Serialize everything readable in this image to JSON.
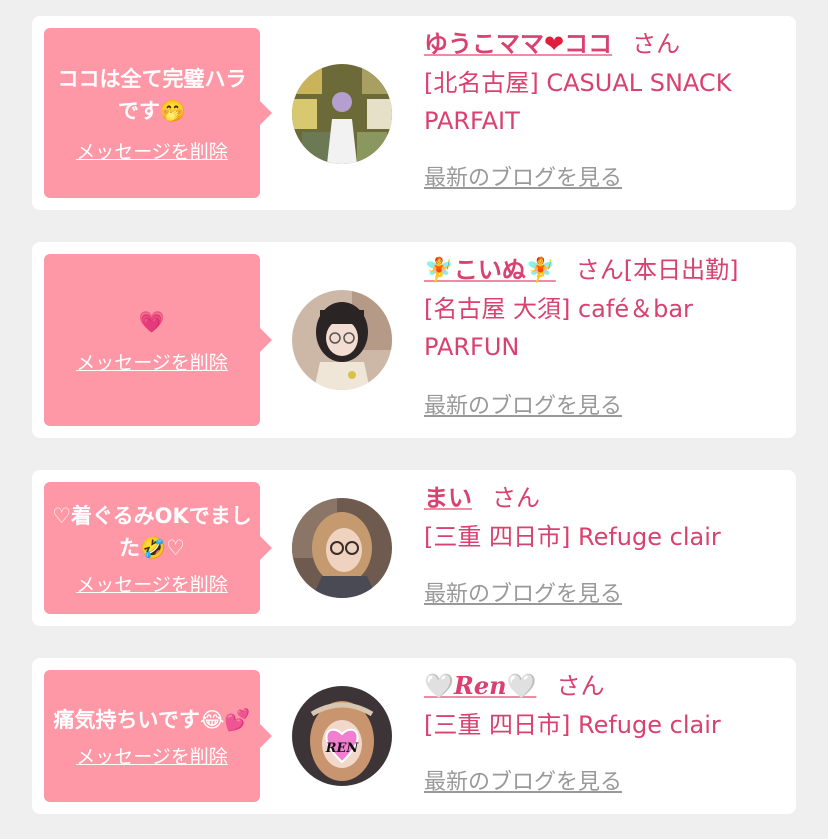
{
  "common": {
    "delete_label": "メッセージを削除",
    "blog_label": "最新のブログを見る",
    "san": "さん"
  },
  "cards": [
    {
      "message": "ココは全て完璧ハラです🤭",
      "name_pre": "ゆうこママ",
      "name_heart": "❤",
      "name_post": "ココ",
      "status": "",
      "shop": "[北名古屋] CASUAL SNACK PARFAIT"
    },
    {
      "message": "💗",
      "name_pre": "🧚",
      "name_mid": "こいぬ",
      "name_post": "🧚",
      "status": "[本日出勤]",
      "shop": "[名古屋 大須] café＆bar PARFUN"
    },
    {
      "message": "♡着ぐるみOKでました🤣♡",
      "name": "まい",
      "shop": "[三重 四日市] Refuge clair"
    },
    {
      "message": "痛気持ちいです😂💕",
      "name_pre": "🤍",
      "name_mid": "Ren",
      "name_post": "🤍",
      "shop": "[三重 四日市] Refuge clair",
      "avatar_text": "REN"
    }
  ]
}
